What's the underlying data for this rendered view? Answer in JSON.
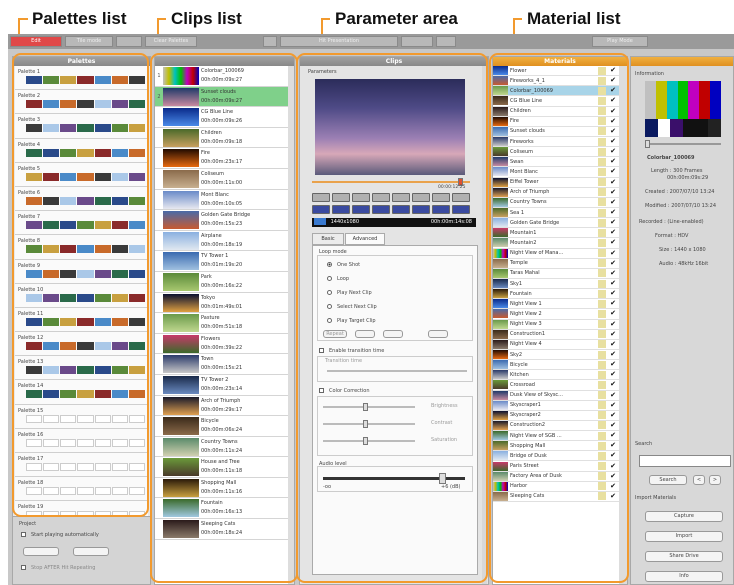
{
  "callouts": [
    {
      "label": "Palettes list"
    },
    {
      "label": "Clips list"
    },
    {
      "label": "Parameter area"
    },
    {
      "label": "Material list"
    }
  ],
  "colors": {
    "accent": "#f29a2e",
    "selected_clip": "#7fd08a",
    "selected_material": "#a8d4e8",
    "title_bar": "#949494"
  },
  "toolbar": {
    "buttons": [
      "Edit",
      "Tile mode",
      "",
      "Clear Palettes",
      "",
      "Hit Presentation",
      "",
      "",
      "Play Mode"
    ]
  },
  "palettes_panel": {
    "title": "Palettes",
    "items": [
      "Palette 1",
      "Palette 2",
      "Palette 3",
      "Palette 4",
      "Palette 5",
      "Palette 6",
      "Palette 7",
      "Palette 8",
      "Palette 9",
      "Palette 10",
      "Palette 11",
      "Palette 12",
      "Palette 13",
      "Palette 14",
      "Palette 15",
      "Palette 16",
      "Palette 17",
      "Palette 18",
      "Palette 19",
      "Palette 20"
    ],
    "project_title": "Project",
    "start_auto": "Start playing automatically",
    "repeat_label": "Stop AFTER Hit Repeating"
  },
  "clips_panel": {
    "items": [
      {
        "name": "Colorbar_100069",
        "dur": "00h:00m:09s:27"
      },
      {
        "name": "Sunset clouds",
        "dur": "00h:00m:09s:27"
      },
      {
        "name": "CG Blue Line",
        "dur": "00h:00m:09s:26"
      },
      {
        "name": "Children",
        "dur": "00h:00m:09s:18"
      },
      {
        "name": "Fire",
        "dur": "00h:00m:23s:17"
      },
      {
        "name": "Coliseum",
        "dur": "00h:00m:11s:00"
      },
      {
        "name": "Mont Blanc",
        "dur": "00h:00m:10s:05"
      },
      {
        "name": "Golden Gate Bridge",
        "dur": "00h:00m:15s:23"
      },
      {
        "name": "Airplane",
        "dur": "00h:00m:18s:19"
      },
      {
        "name": "TV Tower 1",
        "dur": "00h:01m:19s:20"
      },
      {
        "name": "Park",
        "dur": "00h:00m:16s:22"
      },
      {
        "name": "Tokyo",
        "dur": "00h:01m:49s:01"
      },
      {
        "name": "Pasture",
        "dur": "00h:00m:51s:18"
      },
      {
        "name": "Flowers",
        "dur": "00h:00m:39s:22"
      },
      {
        "name": "Town",
        "dur": "00h:00m:15s:21"
      },
      {
        "name": "TV Tower 2",
        "dur": "00h:00m:23s:14"
      },
      {
        "name": "Arch of Triumph",
        "dur": "00h:00m:29s:17"
      },
      {
        "name": "Bicycle",
        "dur": "00h:00m:06s:24"
      },
      {
        "name": "Country Towns",
        "dur": "00h:00m:11s:24"
      },
      {
        "name": "House and Tree",
        "dur": "00h:00m:11s:18"
      },
      {
        "name": "Shopping Mall",
        "dur": "00h:00m:11s:16"
      },
      {
        "name": "Fountain",
        "dur": "00h:00m:16s:13"
      },
      {
        "name": "Sleeping Cats",
        "dur": "00h:00m:18s:24"
      }
    ]
  },
  "param_panel": {
    "title": "Clips",
    "section": "Parameters",
    "timecode": "00:00:12:25",
    "format": "1440x1080",
    "tc_range": "00h:00m:14s:08",
    "tabs": [
      "Basic",
      "Advanced"
    ],
    "loop_mode": "Loop mode",
    "loop_options": [
      "One Shot",
      "Loop",
      "Play Next Clip",
      "Select Next Clip",
      "Play Target Clip"
    ],
    "repeat_btn": "Repeat",
    "transition_enable": "Enable transition time",
    "transition_label": "Transition time",
    "color_correction": "Color Correction",
    "cc_labels": [
      "Brightness",
      "Contrast",
      "Saturation"
    ],
    "audio_level": "Audio level",
    "audio_min": "-oo",
    "audio_max": "+6 (dB)"
  },
  "material_panel": {
    "title": "Materials",
    "items": [
      "Flower",
      "Fireworks_4_1",
      "Colorbar_100069",
      "CG Blue Line",
      "Children",
      "Fire",
      "Sunset clouds",
      "Fireworks",
      "Coliseum",
      "Swan",
      "Mont Blanc",
      "Eiffel Tower",
      "Arch of Triumph",
      "Country Towns",
      "Sea 1",
      "Golden Gate Bridge",
      "Mountain1",
      "Mountain2",
      "Night View of Mana...",
      "Temple",
      "Taras Mahal",
      "Sky1",
      "Fountain",
      "Night View 1",
      "Night View 2",
      "Night View 3",
      "Construction1",
      "Night View 4",
      "Sky2",
      "Bicycle",
      "Kitchen",
      "Crossroad",
      "Dusk View of Skysc...",
      "Skyscraper1",
      "Skyscraper2",
      "Construction2",
      "Night View of SGB ...",
      "Shopping Mall",
      "Bridge of Dusk",
      "Paris Street",
      "Factory Area of Dusk",
      "Harbor",
      "Sleeping Cats"
    ]
  },
  "info_panel": {
    "information": "Information",
    "clip_name": "Colorbar_100069",
    "length": "Length : 300 Frames",
    "length_tc": "00h:00m:09s:29",
    "created": "Created : 2007/07/10 13:24",
    "modified": "Modified : 2007/07/10 13:24",
    "recorded": "Recorded : (Line-enabled)",
    "format": "Format : HDV",
    "size": "Size : 1440 x 1080",
    "audio": "Audio : 48kHz 16bit",
    "search": "Search",
    "search_btn": "Search",
    "import_title": "Import Materials",
    "import_btns": [
      "Capture",
      "Import",
      "Share Drive",
      "Info"
    ]
  }
}
